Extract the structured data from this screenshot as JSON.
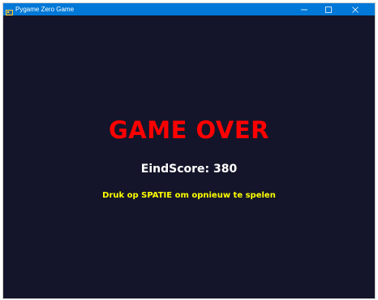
{
  "window": {
    "title": "Pygame Zero Game",
    "icon": "pygame-snake-icon",
    "controls": {
      "minimize_icon": "minimize-icon",
      "maximize_icon": "maximize-icon",
      "close_icon": "close-icon"
    },
    "titlebar_color": "#0078d7"
  },
  "game": {
    "background_color": "#14152a",
    "title": "GAME OVER",
    "title_color": "#ff0000",
    "score_text": "EindScore: 380",
    "score_color": "#ffffff",
    "restart_text": "Druk op SPATIE om opnieuw te spelen",
    "restart_color": "#ffff00"
  }
}
